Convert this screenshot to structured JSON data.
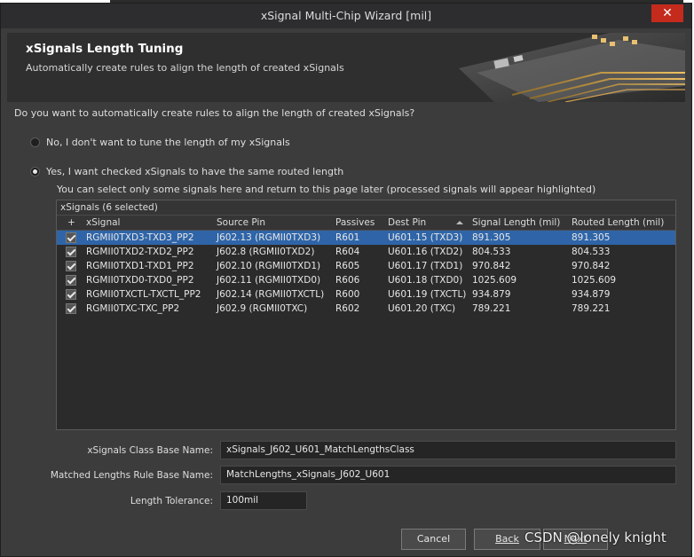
{
  "window": {
    "title": "xSignal Multi-Chip Wizard [mil]",
    "close_glyph": "✕"
  },
  "header": {
    "title": "xSignals Length Tuning",
    "subtitle": "Automatically create rules to align the length of created xSignals"
  },
  "question": "Do you want to automatically create rules to align the length of created xSignals?",
  "options": [
    {
      "label": "No, I don't want to tune the length of my xSignals",
      "selected": false
    },
    {
      "label": "Yes, I want checked xSignals to have the same routed length",
      "selected": true
    }
  ],
  "hint": "You can select only some signals here and return to this page later (processed signals will appear highlighted)",
  "grid": {
    "group_label": "xSignals (6 selected)",
    "columns": [
      "+",
      "xSignal",
      "Source Pin",
      "Passives",
      "Dest Pin",
      "Signal Length (mil)",
      "Routed Length (mil)"
    ],
    "rows": [
      {
        "checked": true,
        "xsignal": "RGMII0TXD3-TXD3_PP2",
        "source": "J602.13 (RGMII0TXD3)",
        "passives": "R601",
        "dest": "U601.15 (TXD3)",
        "signal_len": "891.305",
        "routed_len": "891.305"
      },
      {
        "checked": true,
        "xsignal": "RGMII0TXD2-TXD2_PP2",
        "source": "J602.8 (RGMII0TXD2)",
        "passives": "R604",
        "dest": "U601.16 (TXD2)",
        "signal_len": "804.533",
        "routed_len": "804.533"
      },
      {
        "checked": true,
        "xsignal": "RGMII0TXD1-TXD1_PP2",
        "source": "J602.10 (RGMII0TXD1)",
        "passives": "R605",
        "dest": "U601.17 (TXD1)",
        "signal_len": "970.842",
        "routed_len": "970.842"
      },
      {
        "checked": true,
        "xsignal": "RGMII0TXD0-TXD0_PP2",
        "source": "J602.11 (RGMII0TXD0)",
        "passives": "R606",
        "dest": "U601.18 (TXD0)",
        "signal_len": "1025.609",
        "routed_len": "1025.609"
      },
      {
        "checked": true,
        "xsignal": "RGMII0TXCTL-TXCTL_PP2",
        "source": "J602.14 (RGMII0TXCTL)",
        "passives": "R600",
        "dest": "U601.19 (TXCTL)",
        "signal_len": "934.879",
        "routed_len": "934.879"
      },
      {
        "checked": true,
        "xsignal": "RGMII0TXC-TXC_PP2",
        "source": "J602.9 (RGMII0TXC)",
        "passives": "R602",
        "dest": "U601.20 (TXC)",
        "signal_len": "789.221",
        "routed_len": "789.221"
      }
    ]
  },
  "form": {
    "class_label": "xSignals Class Base Name:",
    "class_value": "xSignals_J602_U601_MatchLengthsClass",
    "rule_label": "Matched Lengths Rule Base Name:",
    "rule_value": "MatchLengths_xSignals_J602_U601",
    "tolerance_label": "Length Tolerance:",
    "tolerance_value": "100mil"
  },
  "buttons": {
    "cancel": "Cancel",
    "back": "Back",
    "next": "Next"
  },
  "watermark": "CSDN @lonely knight",
  "colors": {
    "selection": "#2f65a8",
    "close": "#c42b1c",
    "background": "#3c3c3c"
  }
}
